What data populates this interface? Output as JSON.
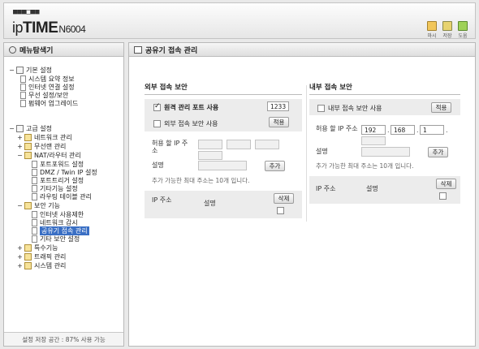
{
  "header": {
    "logo_dots": "■■■□■■",
    "logo_prefix": "ip",
    "logo_brand": "TIME",
    "logo_model": "N6004",
    "buttons": [
      {
        "label": "마시",
        "icon": "home-icon"
      },
      {
        "label": "저장",
        "icon": "save-icon"
      },
      {
        "label": "도움",
        "icon": "help-icon"
      }
    ]
  },
  "sidebar": {
    "title": "메뉴탐색기",
    "footer": "설정 저장 공간 : 87% 사용 가능",
    "items": [
      {
        "label": "기본 설정",
        "pm": "−"
      },
      {
        "label": "시스템 요약 정보"
      },
      {
        "label": "인터넷 연결 설정"
      },
      {
        "label": "무선 설정/보안"
      },
      {
        "label": "펌웨어 업그레이드"
      },
      {
        "label": "고급 설정",
        "pm": "−"
      },
      {
        "label": "네트워크 관리",
        "pm": "+"
      },
      {
        "label": "무선랜 관리",
        "pm": "+"
      },
      {
        "label": "NAT/라우터 관리",
        "pm": "−"
      },
      {
        "label": "포트포워드 설정"
      },
      {
        "label": "DMZ / Twin IP 설정"
      },
      {
        "label": "포트트리거 설정"
      },
      {
        "label": "기타기능 설정"
      },
      {
        "label": "라우팅 테이블 관리"
      },
      {
        "label": "보안 기능",
        "pm": "−"
      },
      {
        "label": "인터넷 사용제한"
      },
      {
        "label": "네트워크 감시"
      },
      {
        "label": "공유기 접속 관리"
      },
      {
        "label": "기타 보안 설정"
      },
      {
        "label": "특수기능",
        "pm": "+"
      },
      {
        "label": "트래픽 관리",
        "pm": "+"
      },
      {
        "label": "시스템 관리",
        "pm": "+"
      }
    ]
  },
  "main": {
    "title": "공유기 접속 관리",
    "external": {
      "title": "외부 접속 보안",
      "remote_label": "원격 관리 포트 사용",
      "remote_checked": true,
      "remote_port": "1233",
      "secure_label": "외부 접속 보안 사용",
      "secure_checked": false,
      "apply_label": "적용",
      "allow_ip_label": "허용 할 IP 주소",
      "desc_label": "설명",
      "add_label": "추가",
      "note": "추가 가능한 최대 주소는 10개 입니다.",
      "col_ip": "IP 주소",
      "col_desc": "설명",
      "delete_label": "삭제"
    },
    "internal": {
      "title": "내부 접속 보안",
      "secure_label": "내부 접속 보안 사용",
      "secure_checked": false,
      "apply_label": "적용",
      "allow_ip_label": "허용 할 IP 주소",
      "ip1": "192",
      "ip2": "168",
      "ip3": "1",
      "ip_sep": ".",
      "desc_label": "설명",
      "add_label": "추가",
      "note": "추가 가능한 최대 주소는 10개 입니다.",
      "col_ip": "IP 주소",
      "col_desc": "설명",
      "delete_label": "삭제"
    }
  }
}
